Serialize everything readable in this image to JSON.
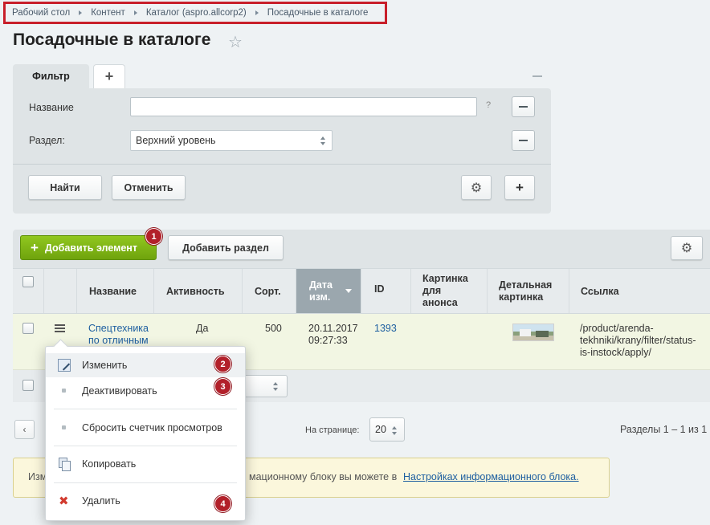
{
  "breadcrumb": [
    "Рабочий стол",
    "Контент",
    "Каталог (aspro.allcorp2)",
    "Посадочные в каталоге"
  ],
  "page": {
    "title": "Посадочные в каталоге"
  },
  "filter": {
    "tab_label": "Фильтр",
    "add_tab_label": "+",
    "name_label": "Название",
    "name_value": "",
    "help_mark": "?",
    "section_label": "Раздел:",
    "section_value": "Верхний уровень",
    "find_label": "Найти",
    "cancel_label": "Отменить"
  },
  "toolbar": {
    "add_element_label": "Добавить элемент",
    "add_section_label": "Добавить раздел"
  },
  "badges": [
    "1",
    "2",
    "3",
    "4"
  ],
  "table": {
    "headers": {
      "name": "Название",
      "active": "Активность",
      "sort": "Сорт.",
      "date_line1": "Дата",
      "date_line2": "изм.",
      "id": "ID",
      "preview_line1": "Картинка",
      "preview_line2": "для",
      "preview_line3": "анонса",
      "detail_line1": "Детальная",
      "detail_line2": "картинка",
      "link": "Ссылка"
    },
    "rows": [
      {
        "name_line1": "Спецтехника",
        "name_line2": "по отличным",
        "active": "Да",
        "sort": "500",
        "date": "20.11.2017",
        "time": "09:27:33",
        "id": "1393",
        "link_line1": "/product/arenda-",
        "link_line2": "tekhniki/krany/filter/status-",
        "link_line3": "is-instock/apply/"
      }
    ]
  },
  "context_menu": {
    "items": [
      {
        "label": "Изменить",
        "icon": "edit-icon"
      },
      {
        "label": "Деактивировать",
        "icon": "bullet-icon"
      },
      {
        "label": "Сбросить счетчик просмотров",
        "icon": "bullet-icon"
      },
      {
        "label": "Копировать",
        "icon": "copy-icon"
      },
      {
        "label": "Удалить",
        "icon": "delete-icon"
      }
    ]
  },
  "pagination": {
    "prev_label": "‹",
    "per_page_label": "На странице:",
    "per_page_value": "20",
    "sections_count": "Разделы 1 – 1 из 1"
  },
  "info": {
    "text_start": "Изм",
    "text_middle": "мационному блоку вы можете в",
    "link_text": "Настройках информационного блока."
  },
  "colors": {
    "accent_green": "#7db217",
    "badge_red": "#b2202a",
    "highlight_red": "#c81f2a"
  }
}
